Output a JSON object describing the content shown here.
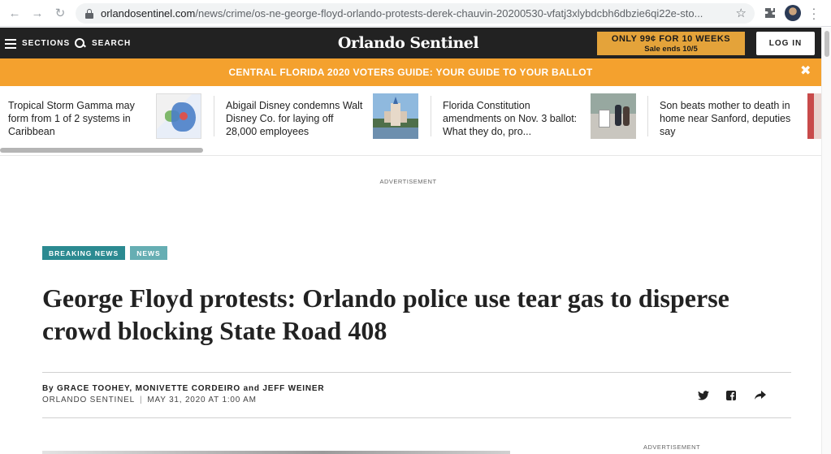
{
  "browser": {
    "url_host": "orlandosentinel.com",
    "url_path": "/news/crime/os-ne-george-floyd-orlando-protests-derek-chauvin-20200530-vfatj3xlybdcbh6dbzie6qi22e-sto...",
    "icons": [
      "back-icon",
      "forward-icon",
      "reload-icon",
      "lock-icon",
      "star-icon",
      "extensions-icon",
      "profile-avatar",
      "menu-icon"
    ]
  },
  "header": {
    "sections_label": "SECTIONS",
    "search_label": "SEARCH",
    "logo": "Orlando Sentinel",
    "promo_line1": "ONLY 99¢ FOR 10 WEEKS",
    "promo_line2": "Sale ends 10/5",
    "login_label": "LOG IN"
  },
  "banner": {
    "text": "CENTRAL FLORIDA 2020 VOTERS GUIDE: YOUR GUIDE TO YOUR BALLOT",
    "close": "✖"
  },
  "stories": [
    {
      "title": "Tropical Storm Gamma may form from 1 of 2 systems in Caribbean"
    },
    {
      "title": "Abigail Disney condemns Walt Disney Co. for laying off 28,000 employees"
    },
    {
      "title": "Florida Constitution amendments on Nov. 3 ballot: What they do, pro..."
    },
    {
      "title": "Son beats mother to death in home near Sanford, deputies say"
    }
  ],
  "ad_label": "ADVERTISEMENT",
  "article": {
    "tags": [
      "BREAKING NEWS",
      "NEWS"
    ],
    "headline": "George Floyd protests: Orlando police use tear gas to disperse crowd blocking State Road 408",
    "byline_prefix": "By",
    "author1": "GRACE TOOHEY",
    "author2": "MONIVETTE CORDEIRO",
    "byline_and": "and",
    "author3": "JEFF WEINER",
    "publication": "ORLANDO SENTINEL",
    "separator": "|",
    "date": "MAY 31, 2020 AT 1:00 AM"
  },
  "side_ad_label": "ADVERTISEMENT",
  "colors": {
    "header_bg": "#222222",
    "promo_bg": "#e4a33a",
    "banner_bg": "#f4a12e",
    "tag_breaking": "#2b8a91",
    "tag_news": "#66aeb3"
  }
}
